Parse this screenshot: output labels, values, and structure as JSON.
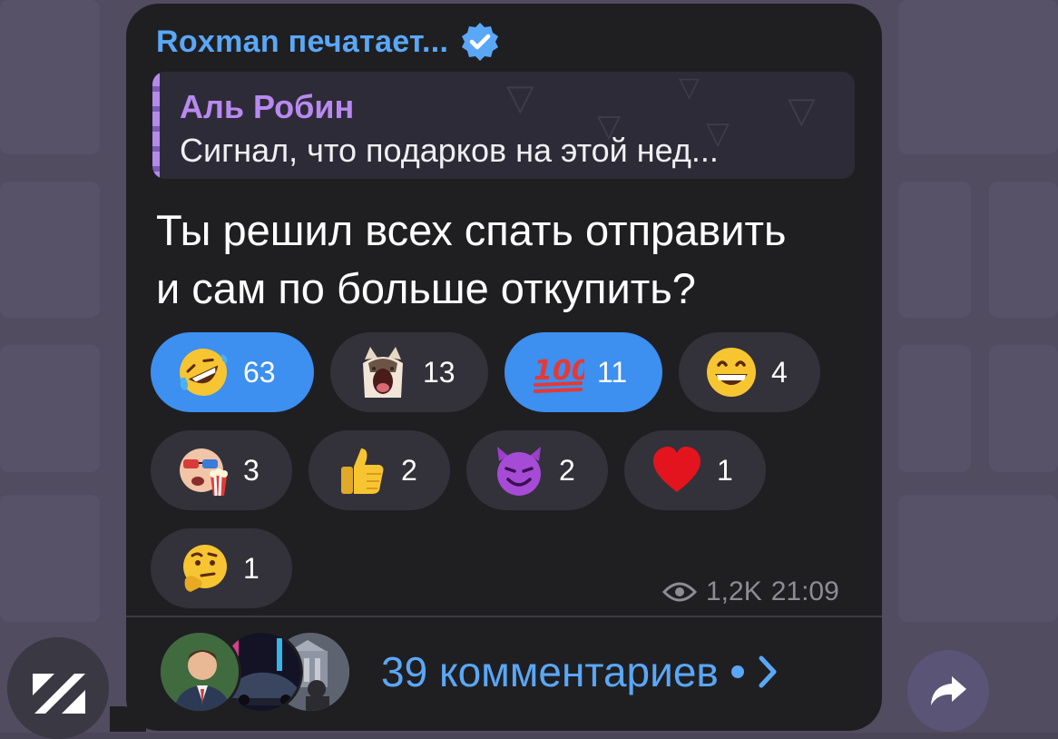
{
  "message": {
    "sender": "Roxman печатает...",
    "reply": {
      "author": "Аль Робин",
      "text": "Сигнал, что подарков на этой нед..."
    },
    "text_line1": "Ты решил всех спать отправить",
    "text_line2": "и сам по больше откупить?",
    "views": "1,2K",
    "time": "21:09"
  },
  "reactions": [
    {
      "emoji": "rofl-emoji",
      "count": "63",
      "active": true
    },
    {
      "emoji": "cat-emoji",
      "count": "13",
      "active": false
    },
    {
      "emoji": "hundred-emoji",
      "count": "11",
      "active": true
    },
    {
      "emoji": "grin-emoji",
      "count": "4",
      "active": false
    },
    {
      "emoji": "popcorn-emoji",
      "count": "3",
      "active": false
    },
    {
      "emoji": "thumbs-up-emoji",
      "count": "2",
      "active": false
    },
    {
      "emoji": "smiling-devil-emoji",
      "count": "2",
      "active": false
    },
    {
      "emoji": "heart-emoji",
      "count": "1",
      "active": false
    },
    {
      "emoji": "thinking-emoji",
      "count": "1",
      "active": false
    }
  ],
  "comments": {
    "label": "39 комментариев"
  },
  "colors": {
    "accent": "#5aa7f6",
    "active_reaction": "#3d8ff0",
    "bubble": "#1f1f22",
    "reply_name": "#b88af0"
  }
}
